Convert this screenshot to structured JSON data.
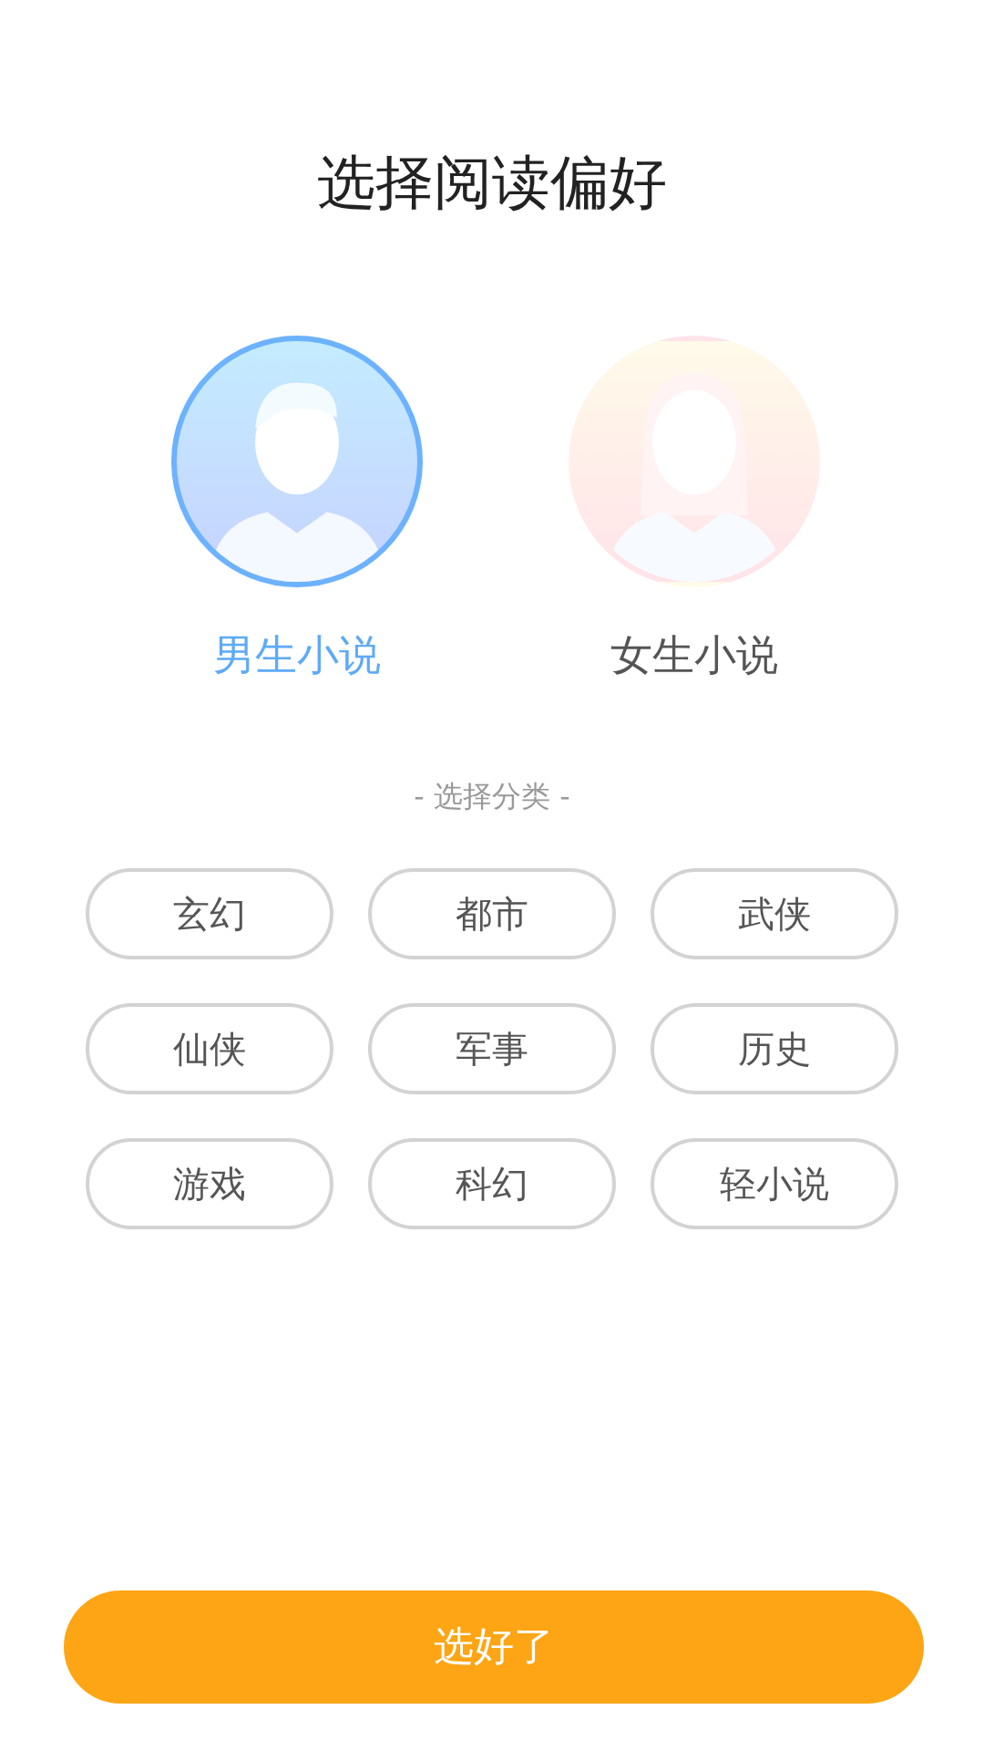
{
  "title": "选择阅读偏好",
  "genders": [
    {
      "label": "男生小说",
      "kind": "male",
      "selected": true
    },
    {
      "label": "女生小说",
      "kind": "female",
      "selected": false
    }
  ],
  "section_label": "- 选择分类 -",
  "categories": [
    "玄幻",
    "都市",
    "武侠",
    "仙侠",
    "军事",
    "历史",
    "游戏",
    "科幻",
    "轻小说"
  ],
  "confirm_button": "选好了"
}
